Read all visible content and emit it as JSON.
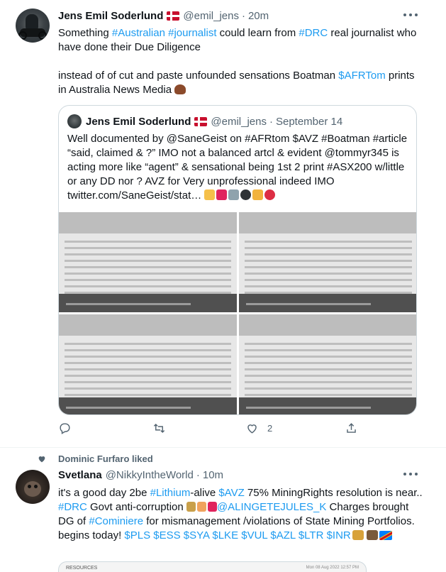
{
  "tweet1": {
    "author_name": "Jens Emil Soderlund",
    "handle": "@emil_jens",
    "time": "20m",
    "text_parts": [
      {
        "text": "Something ",
        "link": false
      },
      {
        "text": "#Australian",
        "link": true
      },
      {
        "text": " ",
        "link": false
      },
      {
        "text": "#journalist",
        "link": true
      },
      {
        "text": " could learn from ",
        "link": false
      },
      {
        "text": "#DRC",
        "link": true
      },
      {
        "text": " real journalist who have done their Due Diligence",
        "link": false
      }
    ],
    "text2_parts": [
      {
        "text": "instead of of cut and paste unfounded sensations Boatman ",
        "link": false
      },
      {
        "text": "$AFRTom",
        "link": true
      },
      {
        "text": " prints in Australia News Media",
        "link": false
      }
    ],
    "quote": {
      "author_name": "Jens Emil Soderlund",
      "handle": "@emil_jens",
      "date": "September 14",
      "text": "Well documented by @SaneGeist on #AFRtom $AVZ #Boatman #article “said, claimed & ?”  IMO  not a balanced artcl & evident @tommyr345 is acting more like “agent” & sensational  being 1st 2 print #ASX200 w/little or any DD nor ? AVZ for   Very unprofessional indeed IMO  twitter.com/SaneGeist/stat…"
    },
    "actions": {
      "reply_count": "",
      "retweet_count": "",
      "like_count": "2",
      "share_count": ""
    }
  },
  "tweet2": {
    "social_context": "Dominic Furfaro liked",
    "author_name": "Svetlana",
    "handle": "@NikkyIntheWorld",
    "time": "10m",
    "text_parts": [
      {
        "text": "it's a good day 2be ",
        "link": false
      },
      {
        "text": "#Lithium",
        "link": true
      },
      {
        "text": "-alive  ",
        "link": false
      },
      {
        "text": "$AVZ",
        "link": true
      },
      {
        "text": " 75% MiningRights resolution is near..  ",
        "link": false
      },
      {
        "text": "#DRC",
        "link": true
      },
      {
        "text": " Govt anti-corruption ",
        "link": false
      },
      {
        "text": "@ALINGETEJULES_K",
        "link": true
      },
      {
        "text": " Charges brought DG of ",
        "link": false
      },
      {
        "text": "#Cominiere",
        "link": true
      },
      {
        "text": " for mismanagement /violations of State Mining Portfolios. begins today!  ",
        "link": false
      },
      {
        "text": "$PLS $ESS $SYA $LKE $VUL $AZL $LTR $INR",
        "link": true
      }
    ],
    "media_label": "RESOURCES",
    "media_date": "Mon 08 Aug 2022 12:57 PM"
  },
  "colors": {
    "link": "#1d9bf0",
    "muted": "#536471",
    "text": "#0f1419",
    "border": "#cfd9de"
  },
  "icons": [
    "more-icon",
    "reply-icon",
    "retweet-icon",
    "like-icon",
    "share-icon",
    "heart-icon",
    "denmark-flag-icon"
  ]
}
